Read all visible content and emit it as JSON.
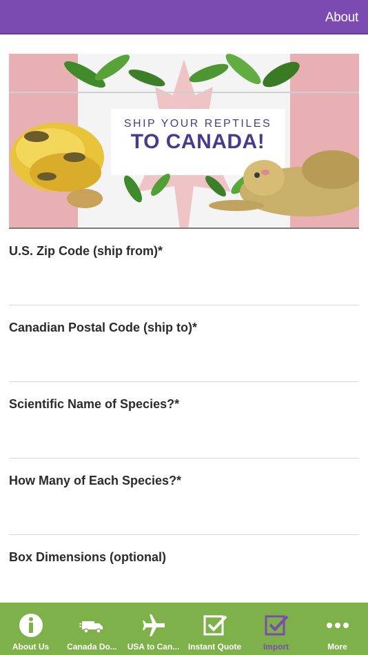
{
  "header": {
    "about_label": "About"
  },
  "banner": {
    "line1": "SHIP YOUR REPTILES",
    "line2": "TO CANADA!"
  },
  "form": {
    "fields": [
      {
        "label": "U.S. Zip Code (ship from)*",
        "value": ""
      },
      {
        "label": "Canadian Postal Code (ship to)*",
        "value": ""
      },
      {
        "label": "Scientific Name of Species?*",
        "value": ""
      },
      {
        "label": "How Many of Each Species?*",
        "value": ""
      },
      {
        "label": "Box Dimensions (optional)",
        "value": ""
      }
    ]
  },
  "tabs": [
    {
      "label": "About Us",
      "icon": "info-icon",
      "active": false
    },
    {
      "label": "Canada Do...",
      "icon": "truck-icon",
      "active": false
    },
    {
      "label": "USA to Can...",
      "icon": "airplane-icon",
      "active": false
    },
    {
      "label": "Instant Quote",
      "icon": "checkbox-icon",
      "active": false
    },
    {
      "label": "Import",
      "icon": "checkbox-icon",
      "active": true
    },
    {
      "label": "More",
      "icon": "more-dots-icon",
      "active": false
    }
  ],
  "colors": {
    "header": "#7b4bb2",
    "tabbar": "#7fb14a",
    "active_tab": "#7b4bb2",
    "banner_text": "#4a3a8e"
  }
}
